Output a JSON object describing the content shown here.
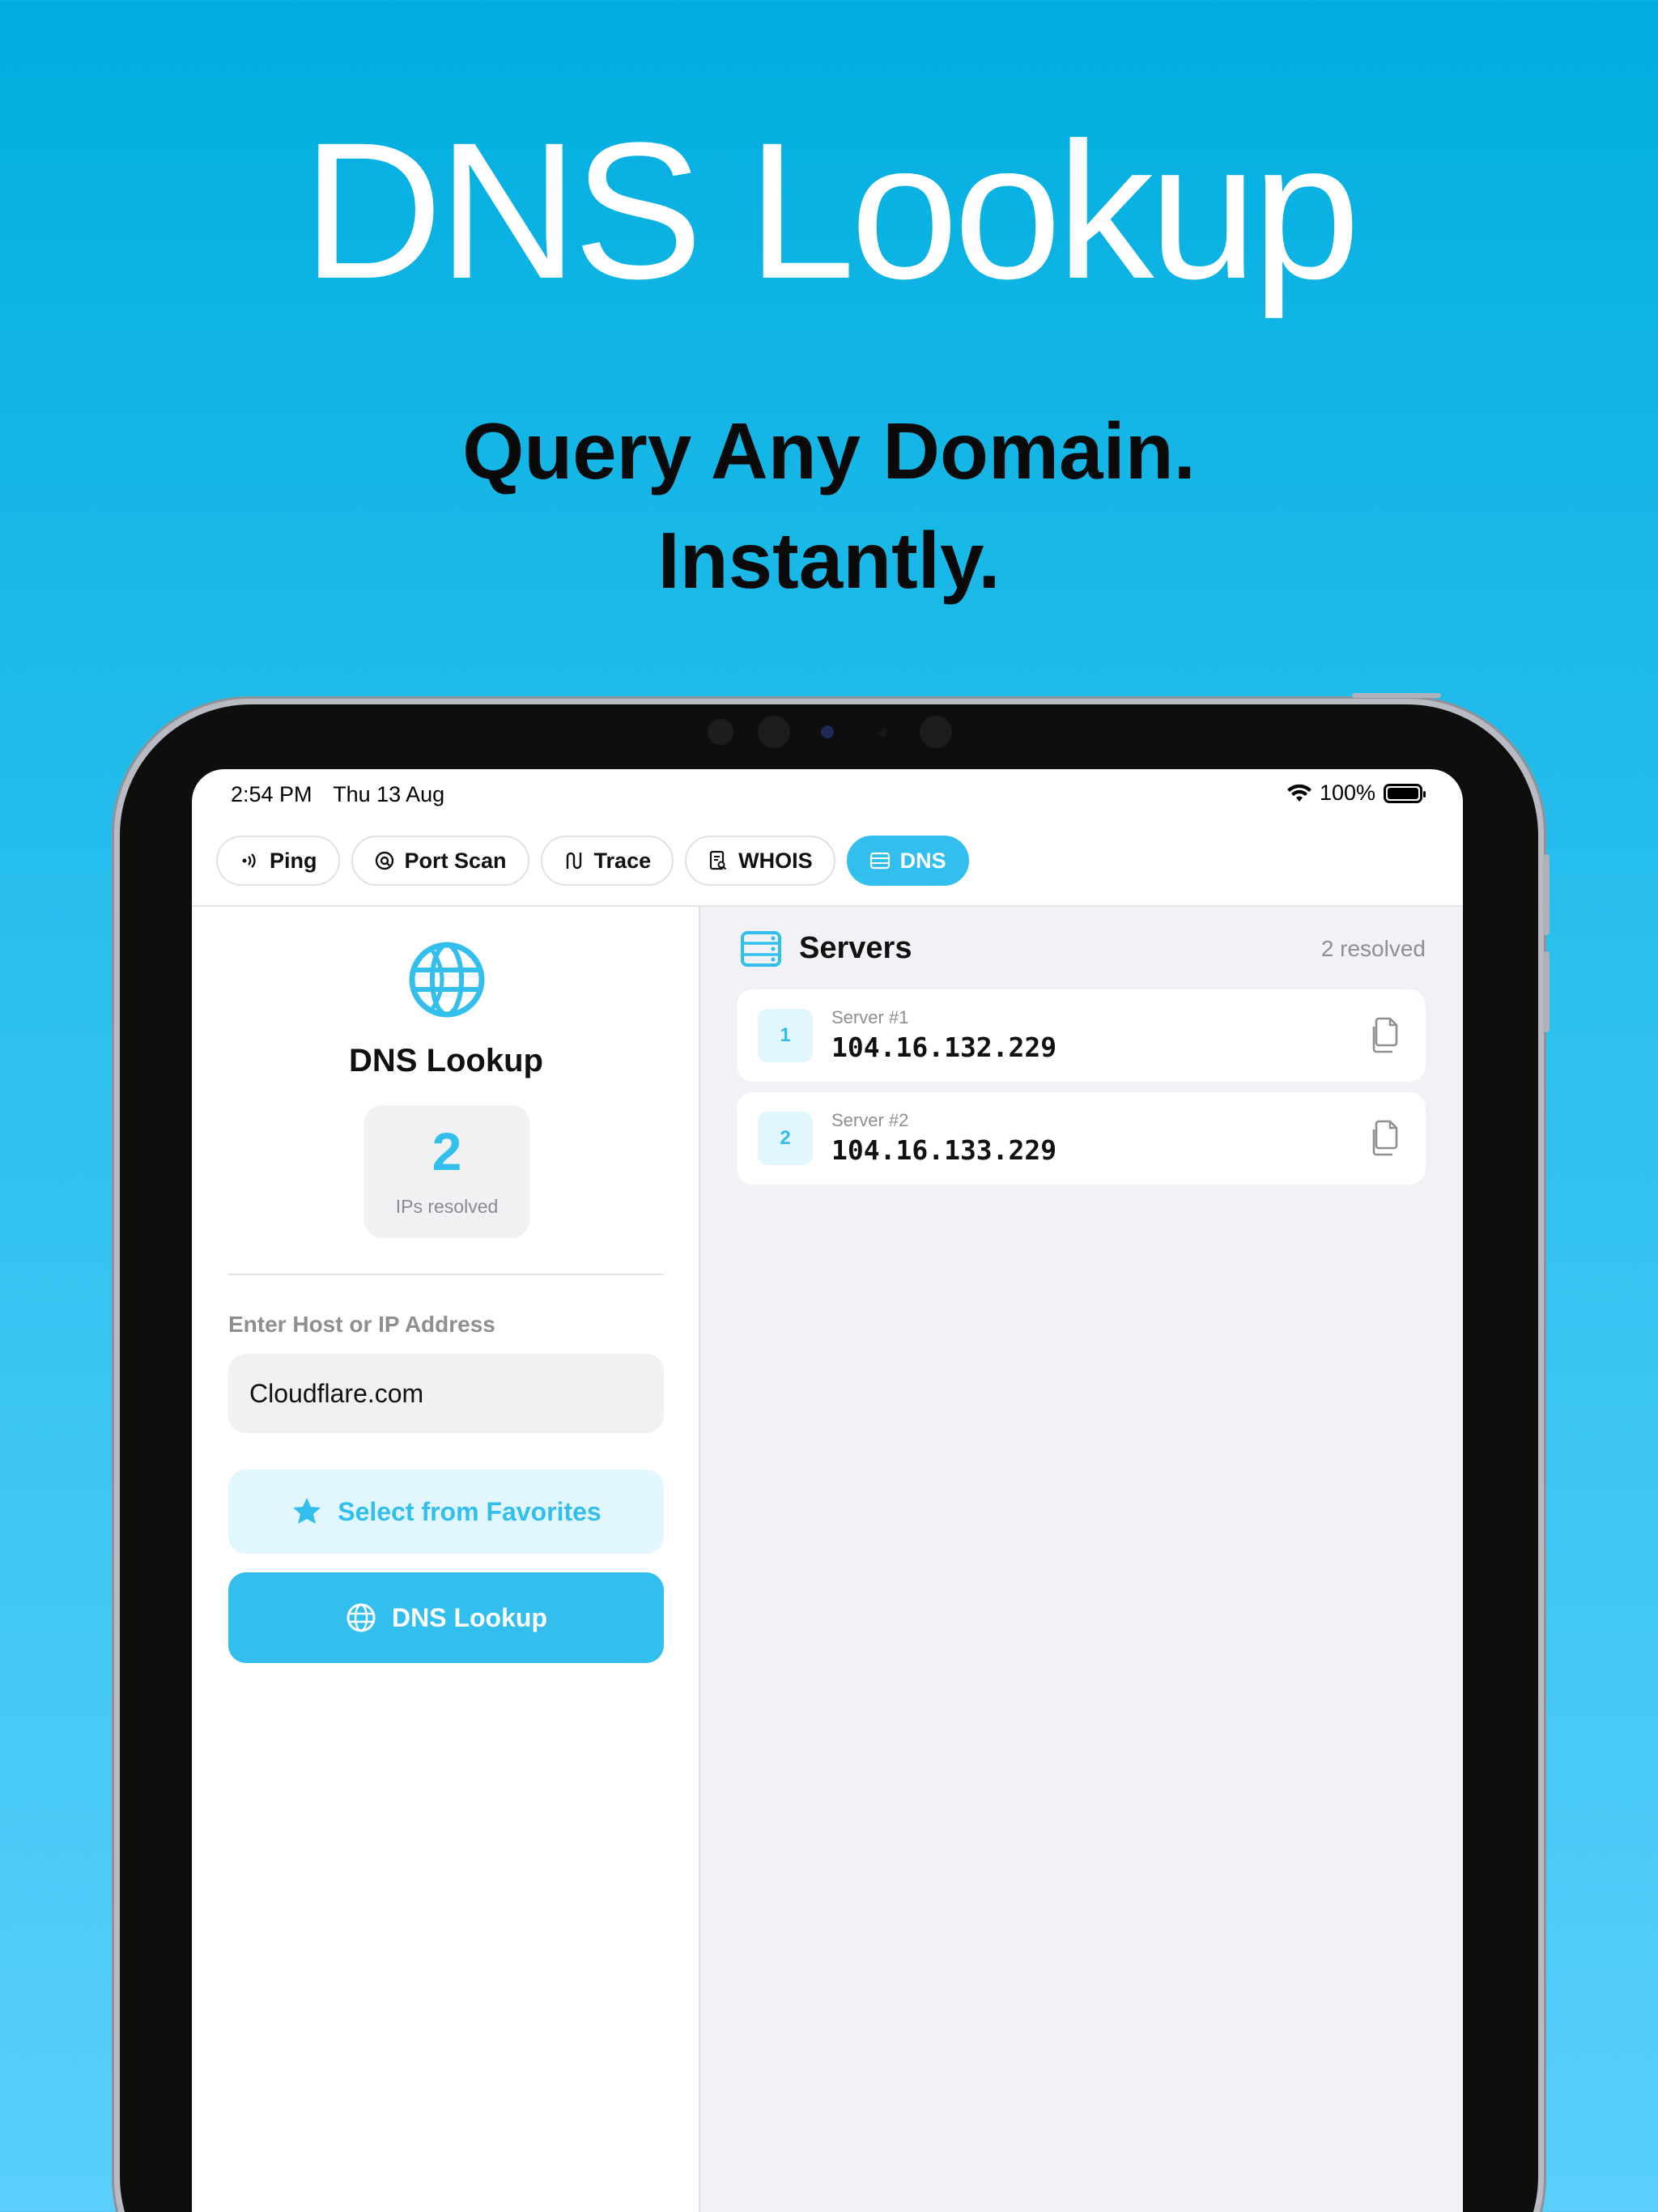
{
  "hero": {
    "title": "DNS Lookup",
    "subtitle_line1": "Query Any Domain.",
    "subtitle_line2": "Instantly."
  },
  "status_bar": {
    "time": "2:54 PM",
    "date": "Thu 13 Aug",
    "battery": "100%",
    "icons": [
      "wifi-icon",
      "battery-icon"
    ]
  },
  "tabs": [
    {
      "label": "Ping",
      "icon": "ping-icon",
      "active": false
    },
    {
      "label": "Port Scan",
      "icon": "port-scan-icon",
      "active": false
    },
    {
      "label": "Trace",
      "icon": "trace-icon",
      "active": false
    },
    {
      "label": "WHOIS",
      "icon": "whois-icon",
      "active": false
    },
    {
      "label": "DNS",
      "icon": "dns-icon",
      "active": true
    }
  ],
  "left_panel": {
    "title": "DNS Lookup",
    "stat_value": "2",
    "stat_label": "IPs resolved",
    "field_label": "Enter Host or IP Address",
    "host_value": "Cloudflare.com",
    "favorites_button": "Select from Favorites",
    "lookup_button": "DNS Lookup"
  },
  "right_panel": {
    "title": "Servers",
    "resolved_count": "2 resolved",
    "servers": [
      {
        "index": "1",
        "label": "Server #1",
        "ip": "104.16.132.229"
      },
      {
        "index": "2",
        "label": "Server #2",
        "ip": "104.16.133.229"
      }
    ]
  },
  "colors": {
    "accent": "#33bfee",
    "accent_light": "#e1f6fd",
    "background_top": "#00aedf",
    "background_bottom": "#5acffb"
  }
}
